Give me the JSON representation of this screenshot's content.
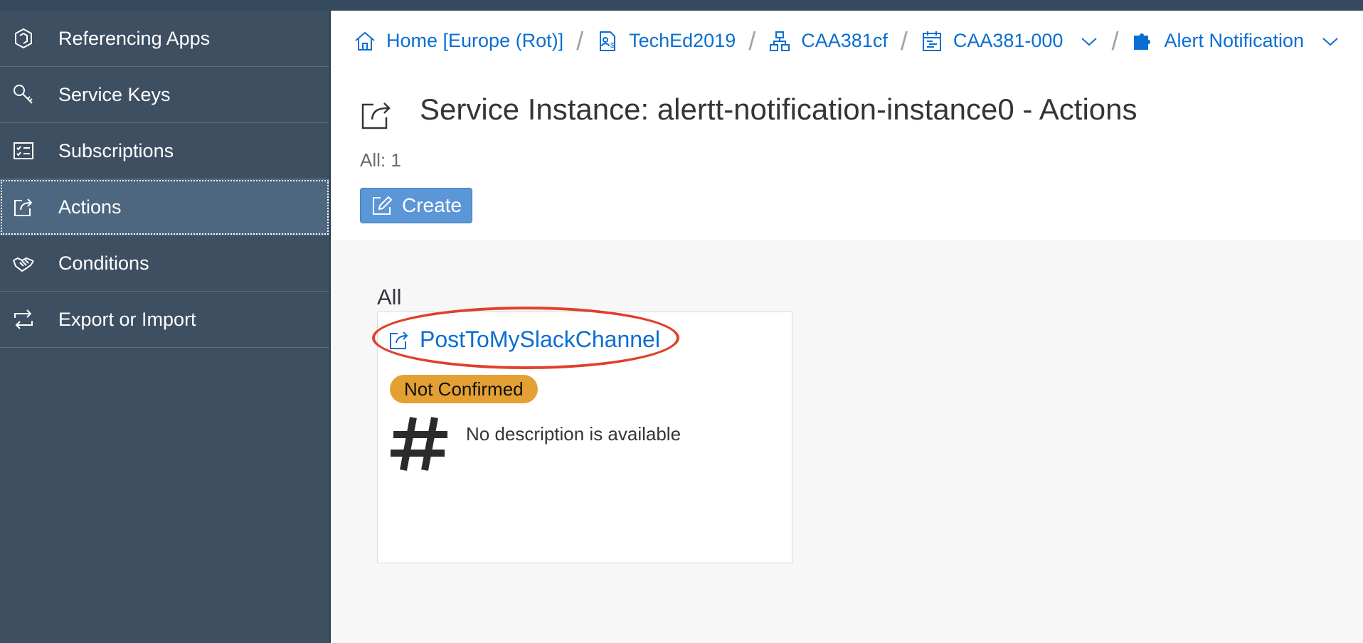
{
  "sidebar": {
    "items": [
      {
        "label": "Referencing Apps",
        "icon": "hexagon-box-icon"
      },
      {
        "label": "Service Keys",
        "icon": "key-icon"
      },
      {
        "label": "Subscriptions",
        "icon": "checklist-icon"
      },
      {
        "label": "Actions",
        "icon": "share-action-icon",
        "selected": true
      },
      {
        "label": "Conditions",
        "icon": "handshake-icon"
      },
      {
        "label": "Export or Import",
        "icon": "export-import-icon"
      }
    ]
  },
  "breadcrumb": {
    "items": [
      {
        "label": "Home [Europe (Rot)]",
        "icon": "home-icon"
      },
      {
        "label": "TechEd2019",
        "icon": "global-account-icon"
      },
      {
        "label": "CAA381cf",
        "icon": "org-hierarchy-icon"
      },
      {
        "label": "CAA381-000",
        "icon": "space-calendar-icon",
        "has_dropdown": true
      },
      {
        "label": "Alert Notification",
        "icon": "puzzle-service-icon",
        "has_dropdown": true
      }
    ]
  },
  "header": {
    "title": "Service Instance: alertt-notification-instance0 - Actions",
    "count_label": "All: 1",
    "create_label": "Create"
  },
  "content": {
    "section_label": "All",
    "tile": {
      "name": "PostToMySlackChannel",
      "status": "Not Confirmed",
      "status_color": "#e4a033",
      "description": "No description is available",
      "type_icon": "hash-slack-icon"
    }
  },
  "colors": {
    "sidebar_bg": "#3d4f61",
    "sidebar_selected": "#4e6780",
    "link": "#0a6ed1",
    "highlight_oval": "#e0402a",
    "button": "#5b96d6"
  }
}
